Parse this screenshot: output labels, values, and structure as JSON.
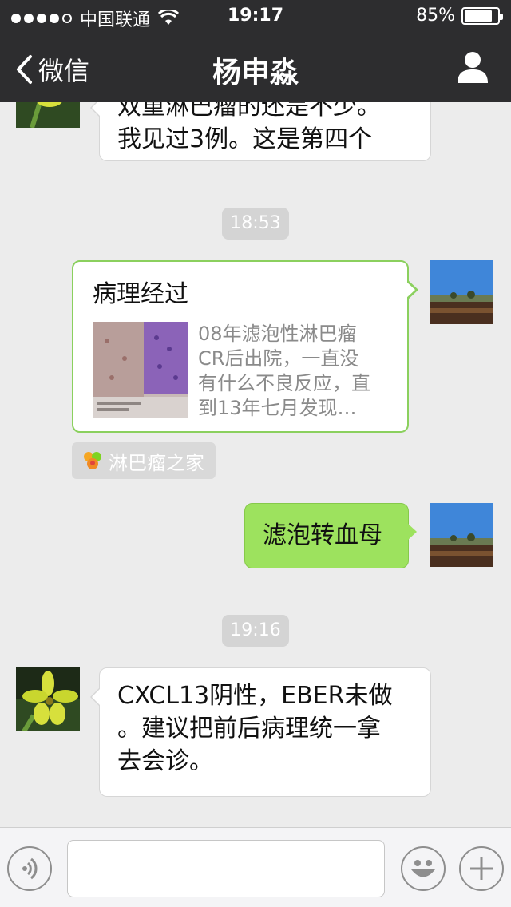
{
  "status_bar": {
    "carrier": "中国联通",
    "time": "19:17",
    "battery": "85%",
    "battery_level": 0.85
  },
  "nav": {
    "back_label": "微信",
    "title": "杨申淼"
  },
  "messages": {
    "first": {
      "line1": "双重淋巴瘤的还是不少。",
      "line2": "我见过3例。这是第四个"
    },
    "ts1": "18:53",
    "card": {
      "title": "病理经过",
      "desc_line1": "08年滤泡性淋巴瘤",
      "desc_line2": "CR后出院，一直没",
      "desc_line3": "有什么不良反应，直",
      "desc_line4": "到13年七月发现…",
      "source": "淋巴瘤之家"
    },
    "sent": "滤泡转血母",
    "ts2": "19:16",
    "last": {
      "line1": "CXCL13阴性，EBER未做",
      "line2": "。建议把前后病理统一拿",
      "line3": "去会诊。"
    }
  }
}
